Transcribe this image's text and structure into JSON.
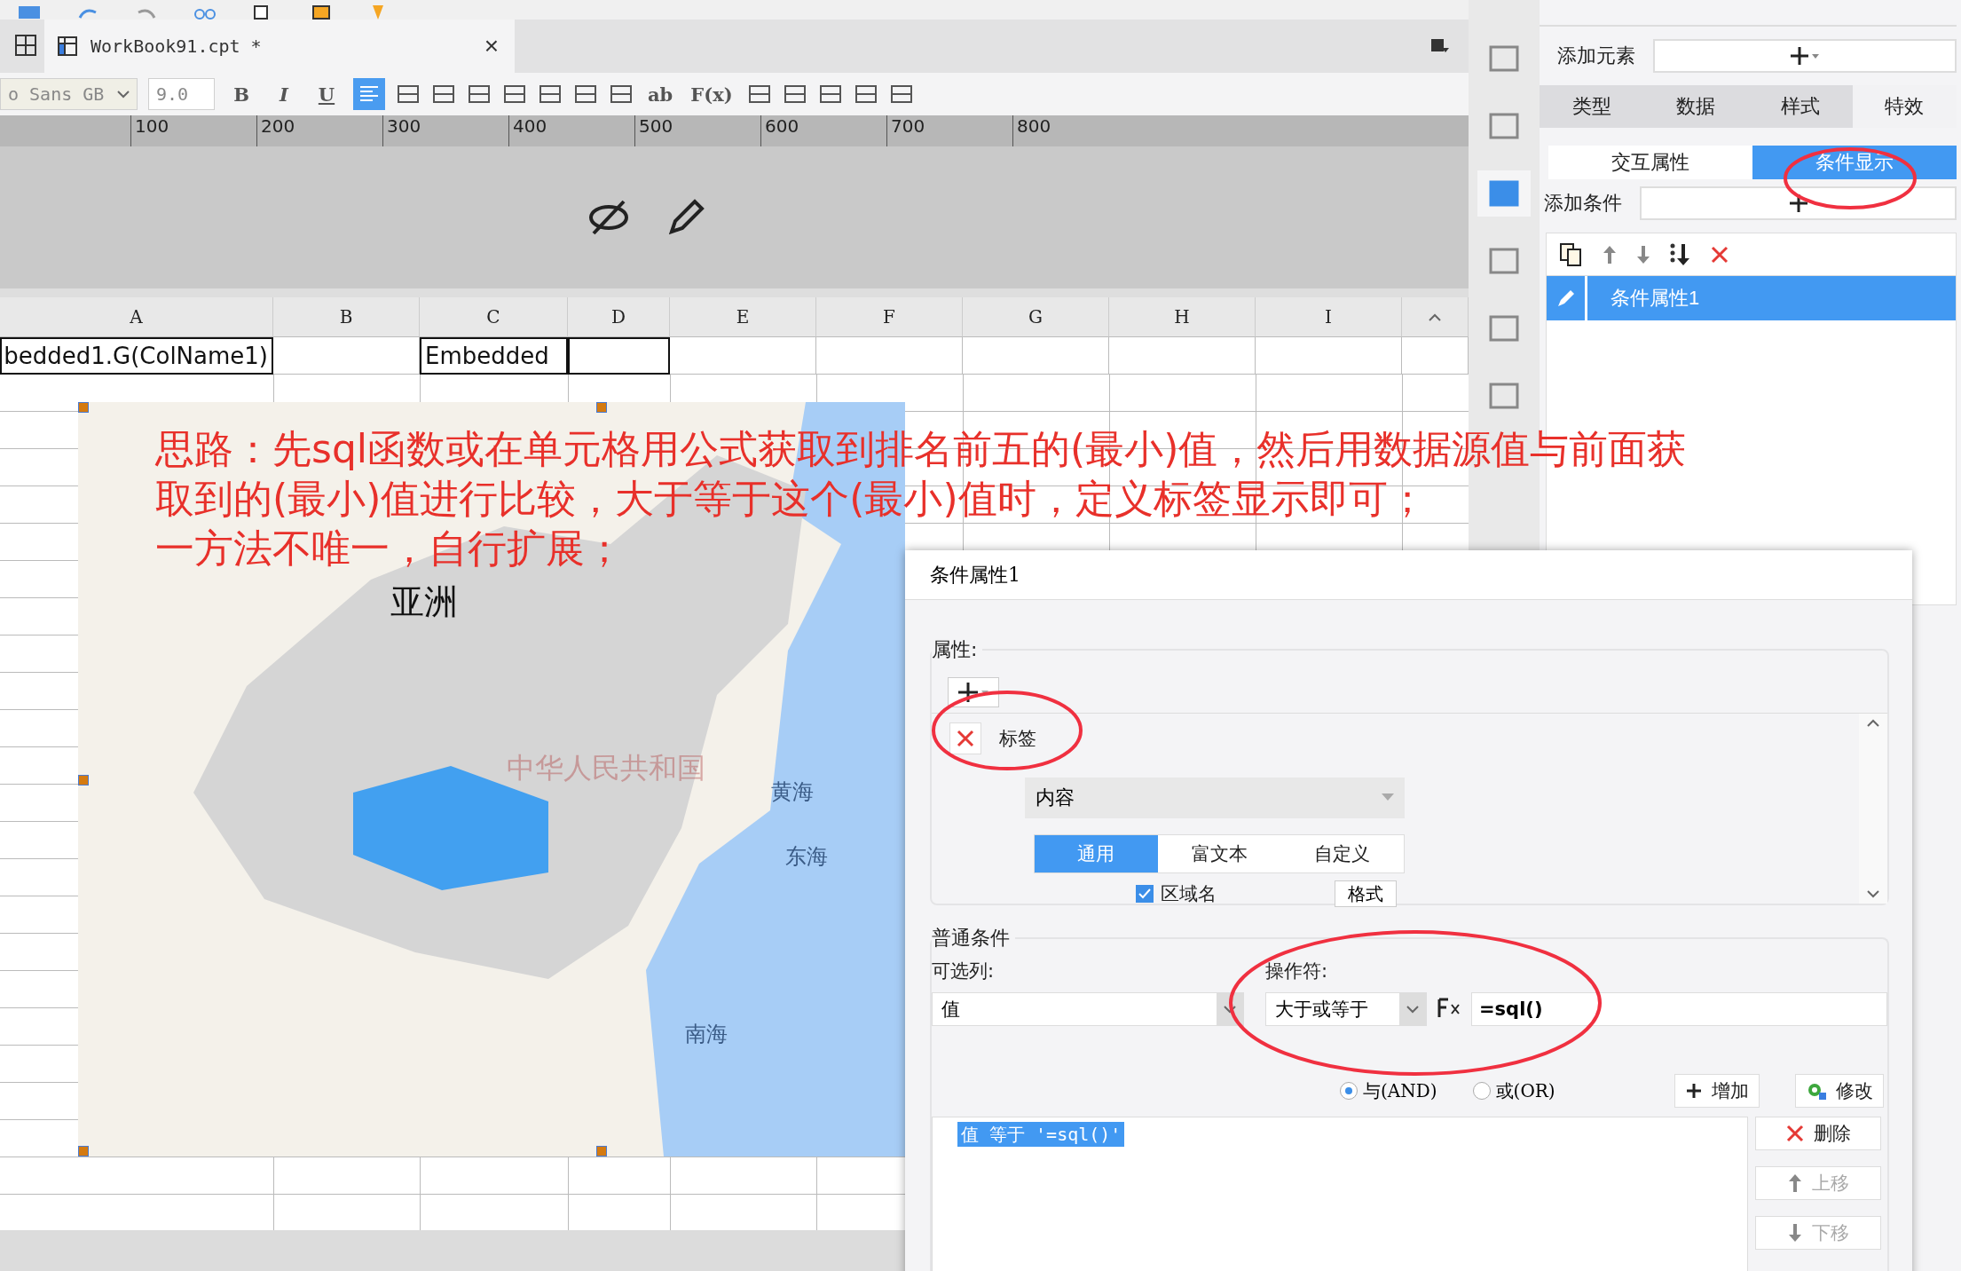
{
  "editor_tab": {
    "title": "WorkBook91.cpt *",
    "close": "×"
  },
  "format_toolbar": {
    "font": "o Sans GB",
    "size": "9.0",
    "text_styles": [
      "B",
      "I",
      "U"
    ],
    "text_tools": [
      "ab",
      "F(x)"
    ]
  },
  "ruler": [
    "100",
    "200",
    "300",
    "400",
    "500",
    "600",
    "700",
    "800"
  ],
  "sheet": {
    "columns": [
      {
        "label": "A",
        "cell": "bedded1.G(ColName1)"
      },
      {
        "label": "B"
      },
      {
        "label": "C",
        "cell": "Embedded"
      },
      {
        "label": "D"
      },
      {
        "label": "E"
      },
      {
        "label": "F"
      },
      {
        "label": "G"
      },
      {
        "label": "H"
      },
      {
        "label": "I"
      }
    ]
  },
  "map": {
    "labels": [
      {
        "text": "亚洲",
        "kind": "continent"
      },
      {
        "text": "中华人民共和国",
        "kind": "country"
      },
      {
        "text": "黄海",
        "kind": "sea"
      },
      {
        "text": "东海",
        "kind": "sea"
      },
      {
        "text": "南海",
        "kind": "sea"
      }
    ]
  },
  "note": [
    "思路：先sql函数或在单元格用公式获取到排名前五的(最小)值，然后用数据源值与前面获",
    "取到的(最小)值进行比较，大于等于这个(最小)值时，定义标签显示即可；",
    "一方法不唯一，自行扩展；"
  ],
  "panel": {
    "add_element_label": "添加元素",
    "tabs": [
      {
        "label": "类型",
        "selected": false
      },
      {
        "label": "数据",
        "selected": false
      },
      {
        "label": "样式",
        "selected": false
      },
      {
        "label": "特效",
        "selected": true
      }
    ],
    "subtabs": [
      {
        "label": "交互属性",
        "selected": false
      },
      {
        "label": "条件显示",
        "selected": true
      }
    ],
    "add_condition_label": "添加条件",
    "conditions": [
      {
        "label": "条件属性1",
        "selected": true
      }
    ]
  },
  "dialog": {
    "title": "条件属性1",
    "attributes": {
      "legend": "属性:",
      "item_label": "标签",
      "dropdown": "内容",
      "tabs": [
        {
          "label": "通用",
          "selected": true
        },
        {
          "label": "富文本",
          "selected": false
        },
        {
          "label": "自定义",
          "selected": false
        }
      ],
      "checkbox": {
        "label": "区域名",
        "checked": true
      },
      "format_button": "格式"
    },
    "condition": {
      "legend": "普通条件",
      "column_label": "可选列:",
      "column_value": "值",
      "operator_label": "操作符:",
      "operator_value": "大于或等于",
      "formula_value": "=sql()",
      "radios": [
        {
          "label": "与(AND)",
          "selected": true
        },
        {
          "label": "或(OR)",
          "selected": false
        }
      ],
      "buttons": [
        {
          "label": "增加",
          "kind": "add"
        },
        {
          "label": "修改",
          "kind": "edit"
        }
      ],
      "list": [
        {
          "text": "值 等于 '=sql()'",
          "selected": true
        }
      ],
      "side_buttons": [
        {
          "label": "删除",
          "kind": "delete",
          "disabled": false
        },
        {
          "label": "上移",
          "kind": "up",
          "disabled": true
        },
        {
          "label": "下移",
          "kind": "down",
          "disabled": true
        }
      ]
    }
  }
}
